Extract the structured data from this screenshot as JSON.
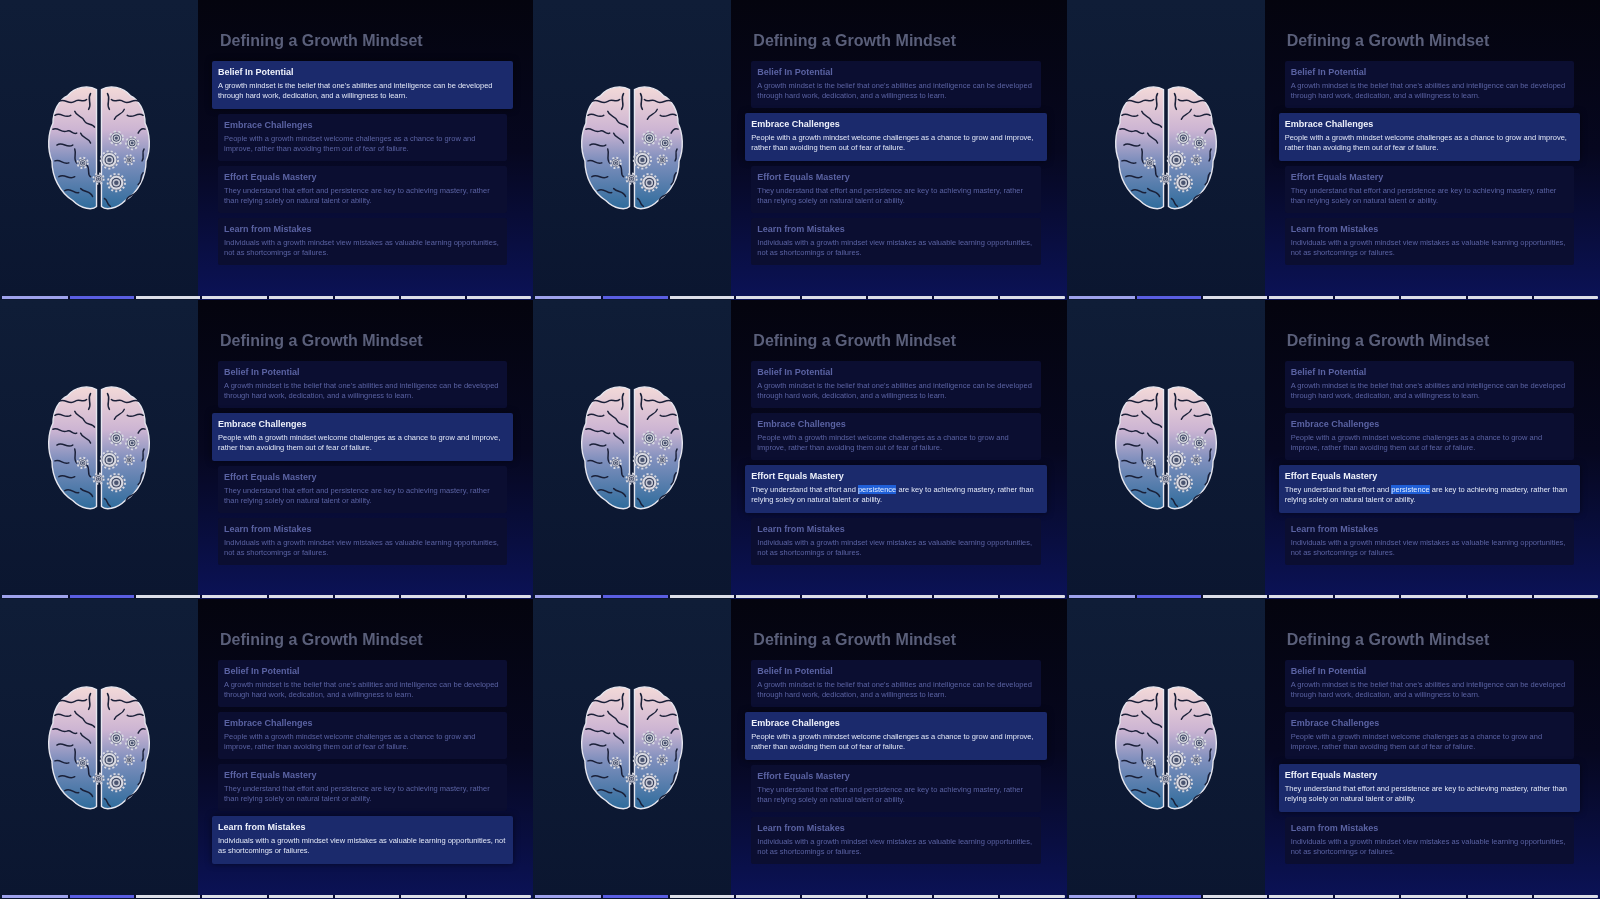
{
  "frames": [
    {
      "title": "Defining a Growth Mindset",
      "cards": [
        {
          "title": "Belief In Potential",
          "description": "A growth mindset is the belief that one's abilities and intelligence can be developed through hard work, dedication, and a willingness to learn.",
          "selected": true
        },
        {
          "title": "Embrace Challenges",
          "description": "People with a growth mindset welcome challenges as a chance to grow and improve, rather than avoiding them out of fear of failure.",
          "selected": false
        },
        {
          "title": "Effort Equals Mastery",
          "description": "They understand that effort and persistence are key to achieving mastery, rather than relying solely on natural talent or ability.",
          "selected": false
        },
        {
          "title": "Learn from Mistakes",
          "description": "Individuals with a growth mindset view mistakes as valuable learning opportunities, not as shortcomings or failures.",
          "selected": false
        }
      ],
      "progress": {
        "played": {
          "level": 0.125
        },
        "buffered": {
          "level": 0.25
        }
      }
    },
    {
      "title": "Defining a Growth Mindset",
      "cards": [
        {
          "title": "Belief In Potential",
          "description": "A growth mindset is the belief that one's abilities and intelligence can be developed through hard work, dedication, and a willingness to learn.",
          "selected": false
        },
        {
          "title": "Embrace Challenges",
          "description": "People with a growth mindset welcome challenges as a chance to grow and improve, rather than avoiding them out of fear of failure.",
          "selected": true
        },
        {
          "title": "Effort Equals Mastery",
          "description": "They understand that effort and persistence are key to achieving mastery, rather than relying solely on natural talent or ability.",
          "selected": false
        },
        {
          "title": "Learn from Mistakes",
          "description": "Individuals with a growth mindset view mistakes as valuable learning opportunities, not as shortcomings or failures.",
          "selected": false
        }
      ],
      "progress": {
        "played": {
          "level": 0.125
        },
        "buffered": {
          "level": 0.25
        }
      }
    },
    {
      "title": "Defining a Growth Mindset",
      "cards": [
        {
          "title": "Belief In Potential",
          "description": "A growth mindset is the belief that one's abilities and intelligence can be developed through hard work, dedication, and a willingness to learn.",
          "selected": false
        },
        {
          "title": "Embrace Challenges",
          "description": "People with a growth mindset welcome challenges as a chance to grow and improve, rather than avoiding them out of fear of failure.",
          "selected": true
        },
        {
          "title": "Effort Equals Mastery",
          "description": "They understand that effort and persistence are key to achieving mastery, rather than relying solely on natural talent or ability.",
          "selected": false
        },
        {
          "title": "Learn from Mistakes",
          "description": "Individuals with a growth mindset view mistakes as valuable learning opportunities, not as shortcomings or failures.",
          "selected": false
        }
      ],
      "progress": {
        "played": {
          "level": 0.125
        },
        "buffered": {
          "level": 0.25
        }
      }
    },
    {
      "title": "Defining a Growth Mindset",
      "cards": [
        {
          "title": "Belief In Potential",
          "description": "A growth mindset is the belief that one's abilities and intelligence can be developed through hard work, dedication, and a willingness to learn.",
          "selected": false
        },
        {
          "title": "Embrace Challenges",
          "description": "People with a growth mindset welcome challenges as a chance to grow and improve, rather than avoiding them out of fear of failure.",
          "selected": true
        },
        {
          "title": "Effort Equals Mastery",
          "description": "They understand that effort and persistence are key to achieving mastery, rather than relying solely on natural talent or ability.",
          "selected": false
        },
        {
          "title": "Learn from Mistakes",
          "description": "Individuals with a growth mindset view mistakes as valuable learning opportunities, not as shortcomings or failures.",
          "selected": false
        }
      ],
      "progress": {
        "played": {
          "level": 0.125
        },
        "buffered": {
          "level": 0.25
        }
      }
    },
    {
      "title": "Defining a Growth Mindset",
      "cards": [
        {
          "title": "Belief In Potential",
          "description": "A growth mindset is the belief that one's abilities and intelligence can be developed through hard work, dedication, and a willingness to learn.",
          "selected": false
        },
        {
          "title": "Embrace Challenges",
          "description": "People with a growth mindset welcome challenges as a chance to grow and improve, rather than avoiding them out of fear of failure.",
          "selected": false
        },
        {
          "title": "Effort Equals Mastery",
          "description": [
            {
              "text": "They understand that effort and ",
              "selected": false
            },
            {
              "text": "persistence",
              "selected": true
            },
            {
              "text": " are key to achieving mastery, rather than relying solely on natural talent or ability.",
              "selected": false
            }
          ],
          "selected": true
        },
        {
          "title": "Learn from Mistakes",
          "description": "Individuals with a growth mindset view mistakes as valuable learning opportunities, not as shortcomings or failures.",
          "selected": false
        }
      ],
      "progress": {
        "played": {
          "level": 0.125
        },
        "buffered": {
          "level": 0.25
        }
      }
    },
    {
      "title": "Defining a Growth Mindset",
      "cards": [
        {
          "title": "Belief In Potential",
          "description": "A growth mindset is the belief that one's abilities and intelligence can be developed through hard work, dedication, and a willingness to learn.",
          "selected": false
        },
        {
          "title": "Embrace Challenges",
          "description": "People with a growth mindset welcome challenges as a chance to grow and improve, rather than avoiding them out of fear of failure.",
          "selected": false
        },
        {
          "title": "Effort Equals Mastery",
          "description": [
            {
              "text": "They understand that effort and ",
              "selected": false
            },
            {
              "text": "persistence",
              "selected": true
            },
            {
              "text": " are key to achieving mastery, rather than relying solely on natural talent or ability.",
              "selected": false
            }
          ],
          "selected": true
        },
        {
          "title": "Learn from Mistakes",
          "description": "Individuals with a growth mindset view mistakes as valuable learning opportunities, not as shortcomings or failures.",
          "selected": false
        }
      ],
      "progress": {
        "played": {
          "level": 0.125
        },
        "buffered": {
          "level": 0.25
        }
      }
    },
    {
      "title": "Defining a Growth Mindset",
      "cards": [
        {
          "title": "Belief In Potential",
          "description": "A growth mindset is the belief that one's abilities and intelligence can be developed through hard work, dedication, and a willingness to learn.",
          "selected": false
        },
        {
          "title": "Embrace Challenges",
          "description": "People with a growth mindset welcome challenges as a chance to grow and improve, rather than avoiding them out of fear of failure.",
          "selected": false
        },
        {
          "title": "Effort Equals Mastery",
          "description": "They understand that effort and persistence are key to achieving mastery, rather than relying solely on natural talent or ability.",
          "selected": false
        },
        {
          "title": "Learn from Mistakes",
          "description": "Individuals with a growth mindset view mistakes as valuable learning opportunities, not as shortcomings or failures.",
          "selected": true
        }
      ],
      "progress": {
        "played": {
          "level": 0.125
        },
        "buffered": {
          "level": 0.25
        }
      }
    },
    {
      "title": "Defining a Growth Mindset",
      "cards": [
        {
          "title": "Belief In Potential",
          "description": "A growth mindset is the belief that one's abilities and intelligence can be developed through hard work, dedication, and a willingness to learn.",
          "selected": false
        },
        {
          "title": "Embrace Challenges",
          "description": "People with a growth mindset welcome challenges as a chance to grow and improve, rather than avoiding them out of fear of failure.",
          "selected": true
        },
        {
          "title": "Effort Equals Mastery",
          "description": "They understand that effort and persistence are key to achieving mastery, rather than relying solely on natural talent or ability.",
          "selected": false
        },
        {
          "title": "Learn from Mistakes",
          "description": "Individuals with a growth mindset view mistakes as valuable learning opportunities, not as shortcomings or failures.",
          "selected": false
        }
      ],
      "progress": {
        "played": {
          "level": 0.125
        },
        "buffered": {
          "level": 0.25
        }
      }
    },
    {
      "title": "Defining a Growth Mindset",
      "cards": [
        {
          "title": "Belief In Potential",
          "description": "A growth mindset is the belief that one's abilities and intelligence can be developed through hard work, dedication, and a willingness to learn.",
          "selected": false
        },
        {
          "title": "Embrace Challenges",
          "description": "People with a growth mindset welcome challenges as a chance to grow and improve, rather than avoiding them out of fear of failure.",
          "selected": false
        },
        {
          "title": "Effort Equals Mastery",
          "description": "They understand that effort and persistence are key to achieving mastery, rather than relying solely on natural talent or ability.",
          "selected": true
        },
        {
          "title": "Learn from Mistakes",
          "description": "Individuals with a growth mindset view mistakes as valuable learning opportunities, not as shortcomings or failures.",
          "selected": false
        }
      ],
      "progress": {
        "played": {
          "level": 0.125
        },
        "buffered": {
          "level": 0.25
        }
      }
    }
  ]
}
